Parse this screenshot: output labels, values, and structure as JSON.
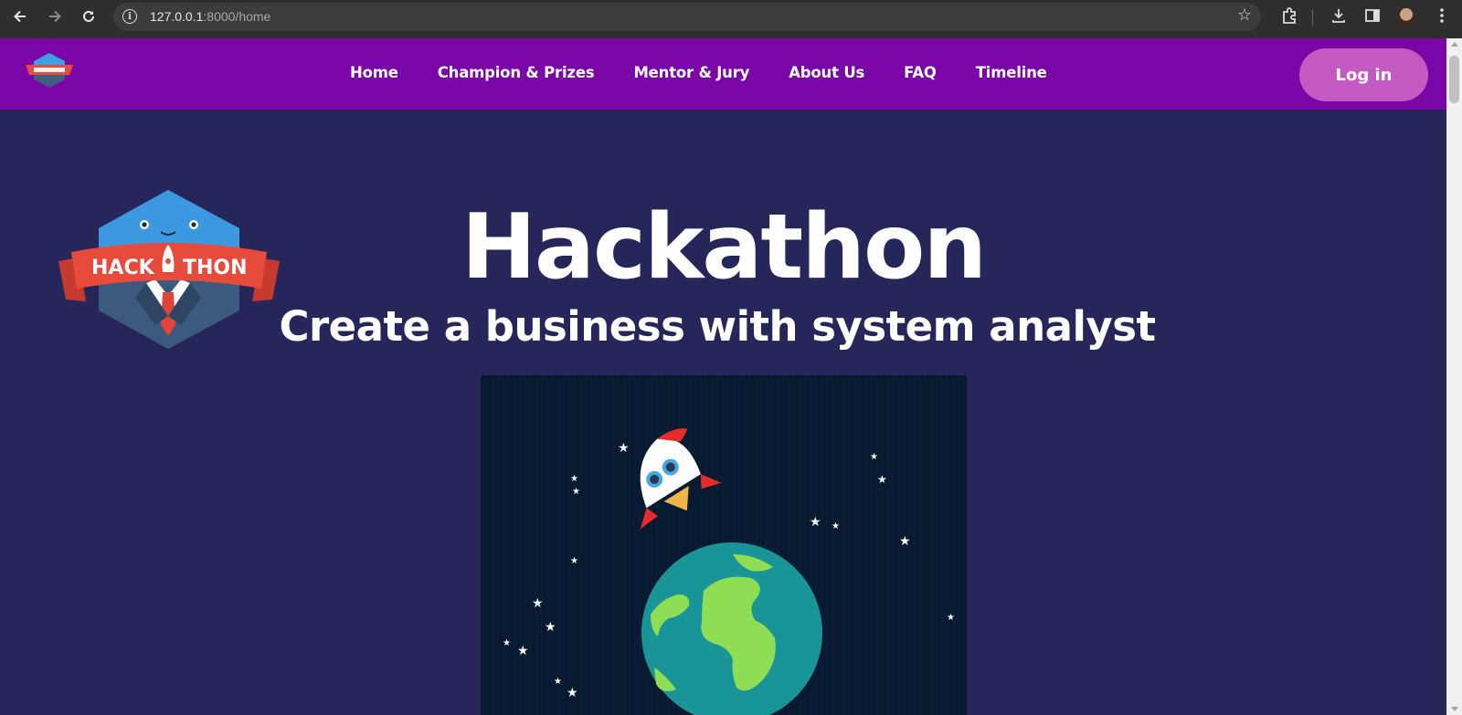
{
  "browser": {
    "url_host": "127.0.0.1",
    "url_path": ":8000/home",
    "icons": [
      "back-arrow-icon",
      "forward-arrow-icon",
      "reload-icon",
      "info-icon",
      "star-icon",
      "extensions-icon",
      "download-icon",
      "side-panel-icon",
      "profile-avatar",
      "more-icon"
    ]
  },
  "navbar": {
    "links": [
      {
        "label": "Home"
      },
      {
        "label": "Champion & Prizes"
      },
      {
        "label": "Mentor & Jury"
      },
      {
        "label": "About Us"
      },
      {
        "label": "FAQ"
      },
      {
        "label": "Timeline"
      }
    ],
    "login_label": "Log in"
  },
  "logo": {
    "text_left": "HACK",
    "text_right": "THON"
  },
  "hero": {
    "title": "Hackathon",
    "subtitle": "Create a business with system analyst"
  },
  "colors": {
    "navbar_bg": "#7a06a8",
    "page_bg": "#26265a",
    "login_bg": "#c45bc2",
    "space_bg": "#071a30"
  }
}
